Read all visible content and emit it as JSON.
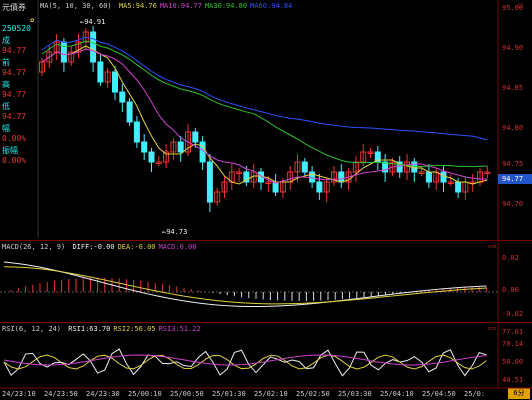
{
  "sidebar": {
    "title": "元債券",
    "items": [
      {
        "label": "250520",
        "color": "#2ee"
      },
      {
        "label": "成",
        "color": "#2ee"
      },
      {
        "label": "94.77",
        "color": "#e33"
      },
      {
        "label": "前",
        "color": "#2ee"
      },
      {
        "label": "94.77",
        "color": "#e33"
      },
      {
        "label": "高",
        "color": "#2ee"
      },
      {
        "label": "94.77",
        "color": "#e33"
      },
      {
        "label": "低",
        "color": "#2ee"
      },
      {
        "label": "94.77",
        "color": "#e33"
      },
      {
        "label": "幅",
        "color": "#2ee"
      },
      {
        "label": "0.00%",
        "color": "#e33"
      },
      {
        "label": "振幅",
        "color": "#2ee"
      },
      {
        "label": "0.00%",
        "color": "#e33"
      }
    ]
  },
  "main_indicator": {
    "name": "MA(5, 10, 30, 60)",
    "values": [
      {
        "text": "MA5:94.76",
        "color": "#e0d040"
      },
      {
        "text": "MA10:94.77",
        "color": "#d040d0"
      },
      {
        "text": "MA30:94.80",
        "color": "#30c030"
      },
      {
        "text": "MA60:94.84",
        "color": "#3050ff"
      }
    ]
  },
  "macd_indicator": {
    "name": "MACD(26, 12, 9)",
    "values": [
      {
        "text": "DIFF:-0.00",
        "color": "#eee"
      },
      {
        "text": "DEA:-0.00",
        "color": "#e0d040"
      },
      {
        "text": "MACD:0.00",
        "color": "#d040d0"
      }
    ]
  },
  "rsi_indicator": {
    "name": "RSI(6, 12, 24)",
    "values": [
      {
        "text": "RSI1:63.70",
        "color": "#eee"
      },
      {
        "text": "RSI2:56.05",
        "color": "#e0d040"
      },
      {
        "text": "RSI3:51.22",
        "color": "#d040d0"
      }
    ]
  },
  "annotations": {
    "high": "94.91",
    "low": "94.73"
  },
  "price_axis": [
    "95.00",
    "94.90",
    "94.85",
    "94.80",
    "94.75",
    "94.70"
  ],
  "current_price": "94.77",
  "macd_axis": [
    "0.02",
    "0.00",
    "-0.02"
  ],
  "rsi_axis": [
    "77.01",
    "70.14",
    "50.00",
    "40.51"
  ],
  "x_axis": [
    "24/23:10",
    "24/23:50",
    "24/23:30",
    "25/00:10",
    "25/00:50",
    "25/01:30",
    "25/02:10",
    "25/02:50",
    "25/03:30",
    "25/04:10",
    "25/04:50",
    "25/0:"
  ],
  "badge": "6分",
  "colors": {
    "up": "#e33",
    "down": "#4ef",
    "ma5": "#e0d040",
    "ma10": "#d040d0",
    "ma30": "#30c030",
    "ma60": "#3050ff",
    "grid": "#7a0000"
  }
}
